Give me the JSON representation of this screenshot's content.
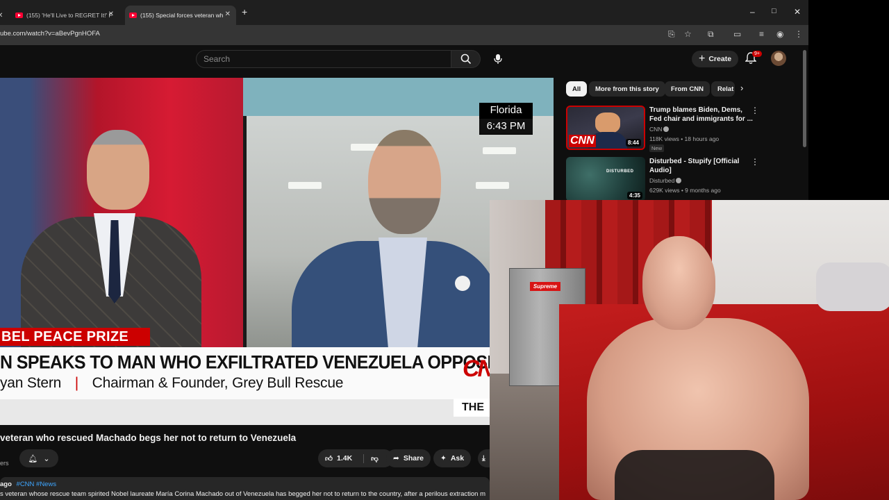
{
  "browser": {
    "tabs": [
      {
        "title": "(155) 'He'll Live to REGRET It!' F",
        "active": false
      },
      {
        "title": "(155) Special forces veteran wh",
        "active": true
      }
    ],
    "new_tab": "+",
    "url": "ube.com/watch?v=aBevPgnHOFA",
    "window_controls": {
      "minimize": "–",
      "maximize": "□",
      "close": "✕"
    }
  },
  "youtube": {
    "search_placeholder": "Search",
    "create_label": "Create",
    "notifications_badge": "9+"
  },
  "video": {
    "overlay": {
      "location": "Florida",
      "time": "6:43 PM",
      "banner": "BEL PEACE PRIZE",
      "headline": "N SPEAKS TO MAN WHO EXFILTRATED VENEZUELA OPPOSITION LEADER",
      "subline_name": "yan Stern",
      "subline_title": "Chairman & Founder, Grey Bull Rescue",
      "network": "CNN",
      "tag": "THE"
    },
    "title": "veteran who rescued Machado begs her not to return to Venezuela",
    "subscribers_fragment": "ers",
    "actions": {
      "likes": "1.4K",
      "share": "Share",
      "ask": "Ask"
    },
    "description": {
      "age": "ago",
      "hashtags": "#CNN #News",
      "text": "s veteran whose rescue team spirited Nobel laureate María Corina Machado out of Venezuela has begged her not to return to the country, after a perilous extraction m"
    }
  },
  "sidebar": {
    "chips": [
      "All",
      "More from this story",
      "From CNN",
      "Relat"
    ],
    "recommendations": [
      {
        "title": "Trump blames Biden, Dems, Fed chair and immigrants for ...",
        "channel": "CNN",
        "meta": "118K views • 18 hours ago",
        "badge": "New",
        "duration": "8:44",
        "thumb_text": "CNN"
      },
      {
        "title": "Disturbed - Stupify [Official Audio]",
        "channel": "Disturbed",
        "meta": "629K views • 9 months ago",
        "badge": "",
        "duration": "4:35",
        "thumb_text": "DISTURBED"
      }
    ]
  },
  "webcam": {
    "fridge_sticker": "Supreme"
  }
}
